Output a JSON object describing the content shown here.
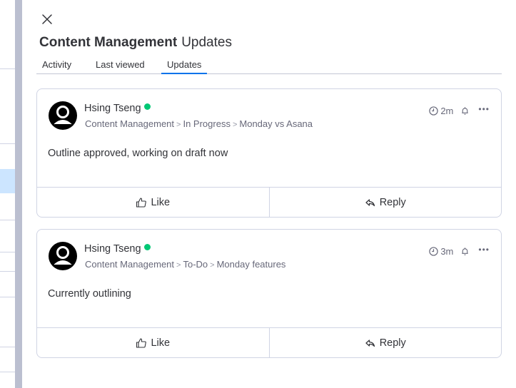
{
  "panel": {
    "title_board": "Content Management",
    "title_section": "Updates",
    "tabs": [
      {
        "label": "Activity",
        "active": false
      },
      {
        "label": "Last viewed",
        "active": false
      },
      {
        "label": "Updates",
        "active": true
      }
    ]
  },
  "colors": {
    "accent": "#0073ea",
    "online": "#00c875",
    "selected_row": "#cce5ff"
  },
  "updates": [
    {
      "author": "Hsing Tseng",
      "online": true,
      "breadcrumb": [
        "Content Management",
        "In Progress",
        "Monday vs Asana"
      ],
      "time": "2m",
      "body": "Outline approved, working on draft now",
      "like_label": "Like",
      "reply_label": "Reply"
    },
    {
      "author": "Hsing Tseng",
      "online": true,
      "breadcrumb": [
        "Content Management",
        "To-Do",
        "Monday features"
      ],
      "time": "3m",
      "body": "Currently outlining",
      "like_label": "Like",
      "reply_label": "Reply"
    }
  ],
  "icons": {
    "close": "close-icon",
    "avatar": "user-avatar-icon",
    "clock": "clock-icon",
    "bell": "bell-icon",
    "more": "more-horizontal-icon",
    "like": "thumbs-up-icon",
    "reply": "reply-arrow-icon"
  }
}
